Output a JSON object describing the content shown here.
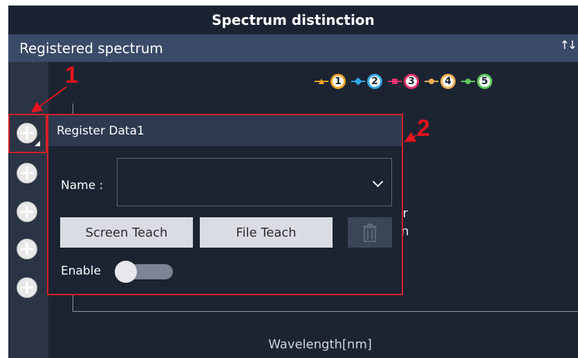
{
  "window": {
    "title": "Spectrum distinction"
  },
  "panel": {
    "title": "Registered spectrum",
    "sort_icon": "sort-arrows-icon"
  },
  "legend": [
    {
      "label": "1",
      "marker": "triangle",
      "color": "#f5a623"
    },
    {
      "label": "2",
      "marker": "diamond",
      "color": "#2ea8e6"
    },
    {
      "label": "3",
      "marker": "square",
      "color": "#e8306a"
    },
    {
      "label": "4",
      "marker": "circle",
      "color": "#f0b050"
    },
    {
      "label": "5",
      "marker": "circle",
      "color": "#5cc85c"
    }
  ],
  "chart": {
    "xlabel": "Wavelength[nm]",
    "behind_text_1": "ster",
    "behind_text_2": "tton"
  },
  "popup": {
    "title": "Register Data1",
    "name_label": "Name :",
    "name_value": "",
    "screen_teach_label": "Screen Teach",
    "file_teach_label": "File Teach",
    "enable_label": "Enable",
    "enable_on": false
  },
  "annotations": {
    "callout_1": "1",
    "callout_2": "2",
    "color": "#e3141d"
  }
}
